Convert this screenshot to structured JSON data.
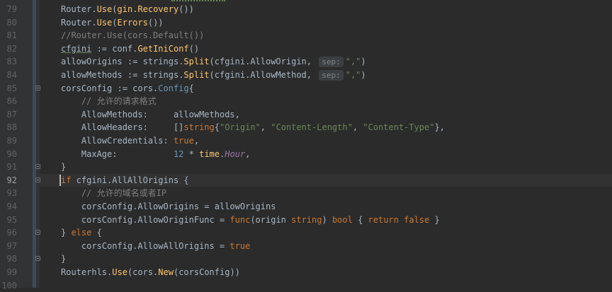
{
  "editor": {
    "lines": [
      {
        "num": "79",
        "tokens": [
          [
            "plain",
            "Router."
          ],
          [
            "fn",
            "Use"
          ],
          [
            "plain",
            "("
          ],
          [
            "fn",
            "gin.Recovery"
          ],
          [
            "plain",
            "())"
          ]
        ]
      },
      {
        "num": "80",
        "tokens": [
          [
            "plain",
            "Router."
          ],
          [
            "fn",
            "Use"
          ],
          [
            "plain",
            "("
          ],
          [
            "fn",
            "Errors"
          ],
          [
            "plain",
            "())"
          ]
        ]
      },
      {
        "num": "81",
        "tokens": [
          [
            "comment",
            "//Router.Use(cors.Default())"
          ]
        ]
      },
      {
        "num": "82",
        "tokens": [
          [
            "under",
            "cfgini"
          ],
          [
            "plain",
            " := conf."
          ],
          [
            "fn",
            "GetIniConf"
          ],
          [
            "plain",
            "()"
          ]
        ]
      },
      {
        "num": "83",
        "tokens": [
          [
            "plain",
            "allowOrigins := strings."
          ],
          [
            "fn",
            "Split"
          ],
          [
            "plain",
            "(cfgini.AllowOrigin, "
          ],
          [
            "hint",
            "sep:"
          ],
          [
            "str",
            "\",\""
          ],
          [
            "plain",
            ")"
          ]
        ]
      },
      {
        "num": "84",
        "tokens": [
          [
            "plain",
            "allowMethods := strings."
          ],
          [
            "fn",
            "Split"
          ],
          [
            "plain",
            "(cfgini.AllowMethod, "
          ],
          [
            "hint",
            "sep:"
          ],
          [
            "str",
            "\",\""
          ],
          [
            "plain",
            ")"
          ]
        ]
      },
      {
        "num": "85",
        "tokens": [
          [
            "plain",
            "corsConfig := cors."
          ],
          [
            "typ",
            "Config"
          ],
          [
            "plain",
            "{"
          ]
        ]
      },
      {
        "num": "86",
        "tokens": [
          [
            "plain",
            "    "
          ],
          [
            "comment",
            "// 允许的请求格式"
          ]
        ]
      },
      {
        "num": "87",
        "tokens": [
          [
            "plain",
            "    AllowMethods:     allowMethods,"
          ]
        ]
      },
      {
        "num": "88",
        "tokens": [
          [
            "plain",
            "    AllowHeaders:     []"
          ],
          [
            "kw",
            "string"
          ],
          [
            "plain",
            "{"
          ],
          [
            "str",
            "\"Origin\""
          ],
          [
            "plain",
            ", "
          ],
          [
            "str",
            "\"Content-Length\""
          ],
          [
            "plain",
            ", "
          ],
          [
            "str",
            "\"Content-Type\""
          ],
          [
            "plain",
            "},"
          ]
        ]
      },
      {
        "num": "89",
        "tokens": [
          [
            "plain",
            "    AllowCredentials: "
          ],
          [
            "kw",
            "true"
          ],
          [
            "plain",
            ","
          ]
        ]
      },
      {
        "num": "90",
        "tokens": [
          [
            "plain",
            "    MaxAge:           "
          ],
          [
            "num",
            "12"
          ],
          [
            "plain",
            " * "
          ],
          [
            "fn",
            "time"
          ],
          [
            "plain",
            "."
          ],
          [
            "it",
            "Hour"
          ],
          [
            "plain",
            ","
          ]
        ]
      },
      {
        "num": "91",
        "tokens": [
          [
            "plain",
            "}"
          ]
        ]
      },
      {
        "num": "92",
        "tokens": [
          [
            "kw",
            "if"
          ],
          [
            "plain",
            " cfgini.AllAllOrigins {"
          ]
        ]
      },
      {
        "num": "93",
        "tokens": [
          [
            "plain",
            "    "
          ],
          [
            "comment",
            "// 允许的域名或者IP"
          ]
        ]
      },
      {
        "num": "94",
        "tokens": [
          [
            "plain",
            "    corsConfig.AllowOrigins = allowOrigins"
          ]
        ]
      },
      {
        "num": "95",
        "tokens": [
          [
            "plain",
            "    corsConfig.AllowOriginFunc = "
          ],
          [
            "kw",
            "func"
          ],
          [
            "plain",
            "(origin "
          ],
          [
            "kw",
            "string"
          ],
          [
            "plain",
            ") "
          ],
          [
            "kw",
            "bool"
          ],
          [
            "plain",
            " { "
          ],
          [
            "kw",
            "return"
          ],
          [
            "plain",
            " "
          ],
          [
            "kw",
            "false"
          ],
          [
            "plain",
            " }"
          ]
        ]
      },
      {
        "num": "96",
        "tokens": [
          [
            "plain",
            "} "
          ],
          [
            "kw",
            "else"
          ],
          [
            "plain",
            " {"
          ]
        ]
      },
      {
        "num": "97",
        "tokens": [
          [
            "plain",
            "    corsConfig.AllowAllOrigins = "
          ],
          [
            "kw",
            "true"
          ]
        ]
      },
      {
        "num": "98",
        "tokens": [
          [
            "plain",
            "}"
          ]
        ]
      },
      {
        "num": "99",
        "tokens": [
          [
            "plain",
            "Routerhls."
          ],
          [
            "fn",
            "Use"
          ],
          [
            "plain",
            "(cors."
          ],
          [
            "fn",
            "New"
          ],
          [
            "plain",
            "(corsConfig))"
          ]
        ]
      },
      {
        "num": "100",
        "tokens": []
      }
    ],
    "current_line": "92",
    "fold_markers": [
      "85",
      "91",
      "92",
      "96",
      "98"
    ]
  },
  "colors": {
    "background": "#2b2b2b",
    "gutter": "#313335",
    "keyword": "#cc7832",
    "function": "#ffc66d",
    "string": "#6a8759",
    "number": "#6897bb",
    "comment": "#808080",
    "text": "#a9b7c6"
  }
}
